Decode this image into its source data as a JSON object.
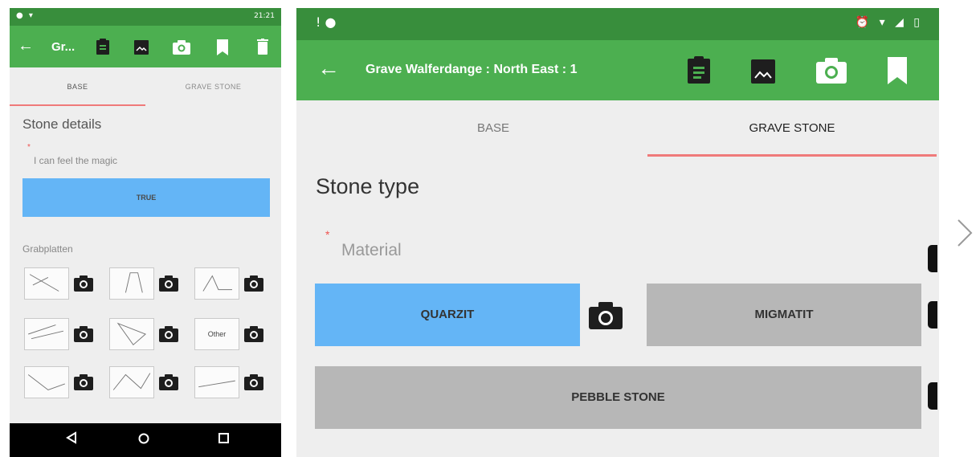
{
  "left_screen": {
    "status_time": "21:21",
    "toolbar_title": "Gr...",
    "tabs": [
      "BASE",
      "GRAVE STONE"
    ],
    "heading": "Stone details",
    "field_label": "I can feel the magic",
    "button_label": "TRUE",
    "section_label": "Grabplatten",
    "other_label": "Other",
    "colors": {
      "toolbar": "#4caf50",
      "statusbar": "#388e3c",
      "button": "#64b5f6",
      "tab_indicator": "#ef7a7a"
    }
  },
  "right_screen": {
    "toolbar_title": "Grave Walferdange : North East : 1",
    "tabs": [
      "BASE",
      "GRAVE STONE"
    ],
    "active_tab": "GRAVE STONE",
    "heading": "Stone type",
    "field_label": "Material",
    "options": [
      "QUARZIT",
      "MIGMATIT",
      "PEBBLE STONE"
    ],
    "selected_option": "QUARZIT",
    "colors": {
      "selected": "#64b5f6",
      "unselected": "#b7b7b7"
    }
  },
  "icons": [
    "back-arrow-icon",
    "clipboard-icon",
    "image-icon",
    "camera-icon",
    "bookmark-icon",
    "trash-icon",
    "chevron-right-icon"
  ]
}
